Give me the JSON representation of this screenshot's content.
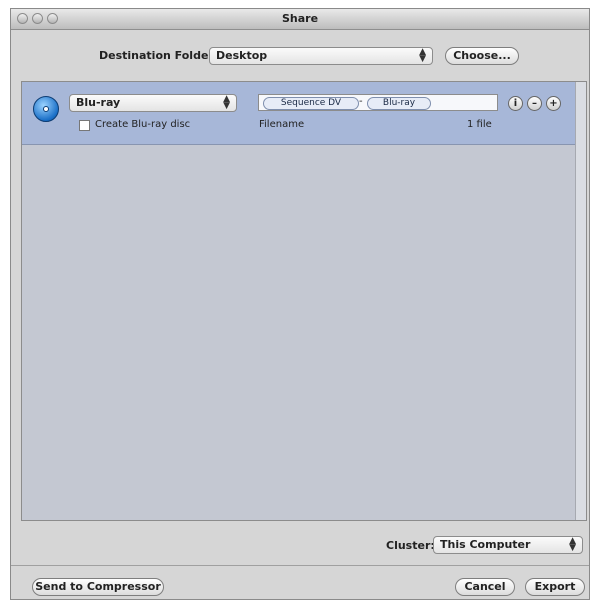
{
  "window": {
    "title": "Share"
  },
  "destination": {
    "label": "Destination Folder:",
    "value": "Desktop",
    "choose_label": "Choose..."
  },
  "job": {
    "format": "Blu-ray",
    "create_disc_label": "Create Blu-ray disc",
    "create_disc_checked": false,
    "filename_tokens": [
      "Sequence DV",
      "Blu-ray"
    ],
    "token_separator": "-",
    "filename_label": "Filename",
    "file_count": "1 file"
  },
  "cluster": {
    "label": "Cluster:",
    "value": "This Computer"
  },
  "footer": {
    "send_label": "Send to Compressor",
    "cancel_label": "Cancel",
    "export_label": "Export"
  },
  "icons": [
    "disc-icon",
    "info-icon",
    "minus-icon",
    "plus-icon",
    "popup-arrows-icon"
  ]
}
